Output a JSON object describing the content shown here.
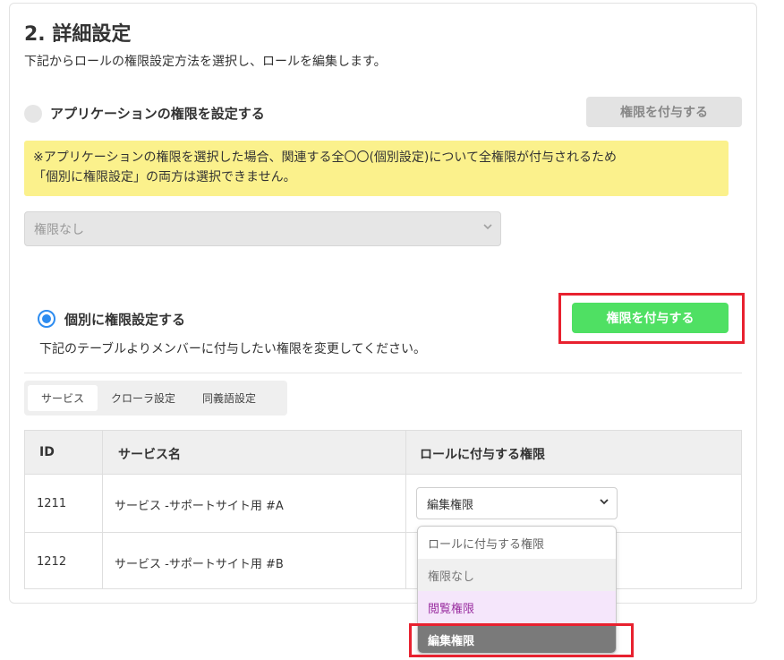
{
  "section": {
    "title": "2. 詳細設定",
    "description": "下記からロールの権限設定方法を選択し、ロールを編集します。"
  },
  "option_app": {
    "label": "アプリケーションの権限を設定する",
    "button_label": "権限を付与する",
    "notice_line1": "※アプリケーションの権限を選択した場合、関連する全〇〇(個別設定)について全権限が付与されるため",
    "notice_line2": "「個別に権限設定」の両方は選択できません。",
    "select_value": "権限なし"
  },
  "option_individual": {
    "label": "個別に権限設定する",
    "button_label": "権限を付与する",
    "description": "下記のテーブルよりメンバーに付与したい権限を変更してください。"
  },
  "tabs": [
    {
      "label": "サービス",
      "active": true
    },
    {
      "label": "クローラ設定",
      "active": false
    },
    {
      "label": "同義語設定",
      "active": false
    }
  ],
  "table": {
    "headers": [
      "ID",
      "サービス名",
      "ロールに付与する権限"
    ],
    "rows": [
      {
        "id": "1211",
        "name": "サービス -サポートサイト用 #A",
        "permission": "編集権限"
      },
      {
        "id": "1212",
        "name": "サービス -サポートサイト用 #B",
        "permission": ""
      }
    ]
  },
  "dropdown": {
    "options": [
      "ロールに付与する権限",
      "権限なし",
      "閲覧権限",
      "編集権限"
    ],
    "highlighted": "編集権限"
  },
  "colors": {
    "primary_button": "#4fe063",
    "radio_selected": "#2d8cf0",
    "notice_bg": "#fbf18c",
    "highlight_border": "#e8212f",
    "view_option": "#9a2fa0"
  },
  "icons": {
    "select_chevron": "chevron-down-icon"
  }
}
